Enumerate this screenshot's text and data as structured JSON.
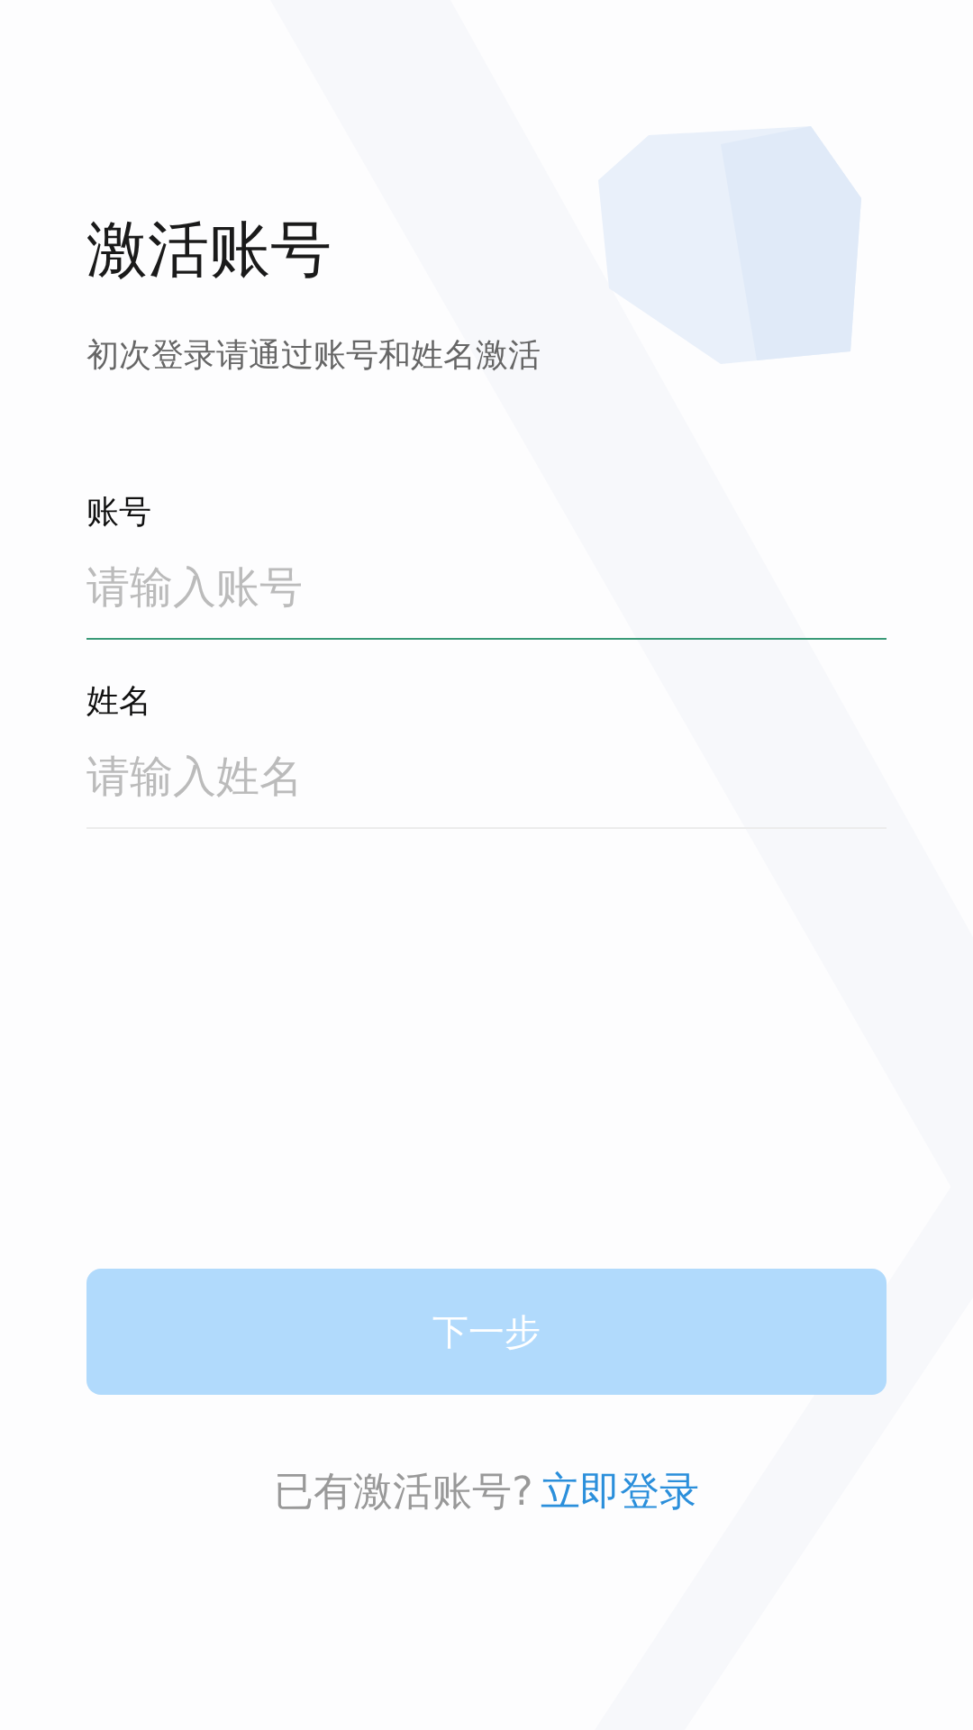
{
  "title": "激活账号",
  "subtitle": "初次登录请通过账号和姓名激活",
  "fields": [
    {
      "label": "账号",
      "placeholder": "请输入账号",
      "focused": true
    },
    {
      "label": "姓名",
      "placeholder": "请输入姓名",
      "focused": false
    }
  ],
  "next_button": {
    "label": "下一步",
    "disabled": true
  },
  "footer": {
    "prompt": "已有激活账号?",
    "link": "立即登录"
  }
}
